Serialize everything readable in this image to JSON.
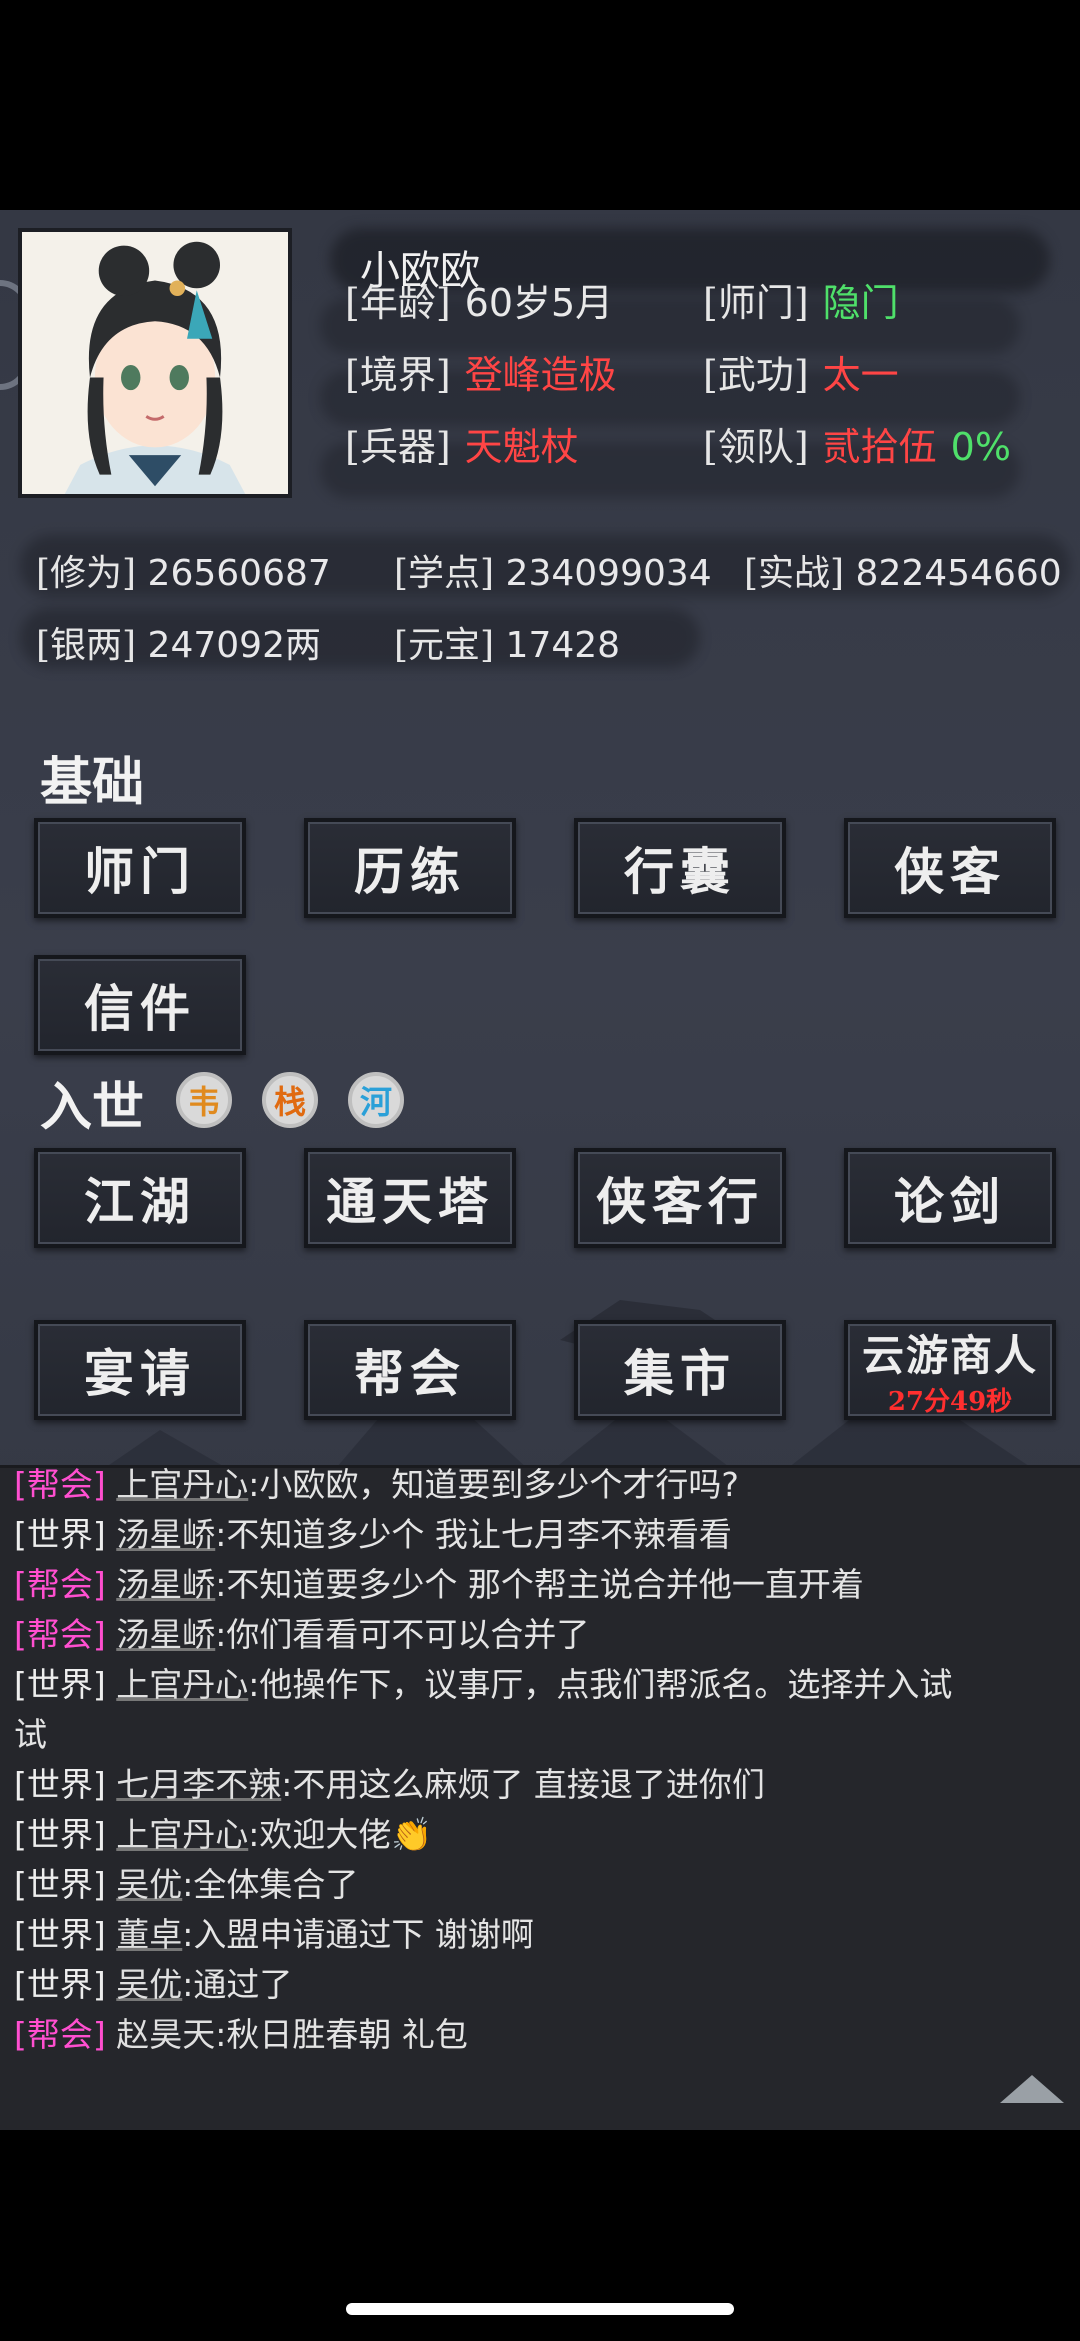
{
  "player": {
    "name": "小欧欧",
    "info": [
      {
        "label": "[年龄]",
        "value": "60岁5月",
        "color": "white"
      },
      {
        "label": "[师门]",
        "value": "隐门",
        "color": "green"
      },
      {
        "label": "[境界]",
        "value": "登峰造极",
        "color": "red"
      },
      {
        "label": "[武功]",
        "value": "太一",
        "color": "red"
      },
      {
        "label": "[兵器]",
        "value": "天魁杖",
        "color": "red"
      },
      {
        "label": "[领队]",
        "value": "贰拾伍",
        "value2": "0%",
        "color": "red"
      }
    ],
    "stats": [
      {
        "label": "[修为]",
        "value": "26560687"
      },
      {
        "label": "[学点]",
        "value": "234099034"
      },
      {
        "label": "[实战]",
        "value": "822454660"
      },
      {
        "label": "[银两]",
        "value": "247092两"
      },
      {
        "label": "[元宝]",
        "value": "17428"
      }
    ]
  },
  "sections": {
    "basic_title": "基础",
    "basic_buttons": [
      "师门",
      "历练",
      "行囊",
      "侠客",
      "信件"
    ],
    "world_title": "入世",
    "seals": [
      {
        "glyph": "韦",
        "color": "#e08a1e"
      },
      {
        "glyph": "栈",
        "color": "#e06a10"
      },
      {
        "glyph": "河",
        "color": "#2aa0d8"
      }
    ],
    "world_buttons": [
      "江湖",
      "通天塔",
      "侠客行",
      "论剑",
      "宴请",
      "帮会",
      "集市",
      "云游商人"
    ],
    "merchant_timer": "27分49秒"
  },
  "chat": [
    {
      "channel": "[帮会]",
      "type": "guild",
      "speaker": "上官丹心",
      "text": ":小欧欧，知道要到多少个才行吗?"
    },
    {
      "channel": "[世界]",
      "type": "world",
      "speaker": "汤星峤",
      "text": ":不知道多少个 我让七月李不辣看看"
    },
    {
      "channel": "[帮会]",
      "type": "guild",
      "speaker": "汤星峤",
      "text": ":不知道要多少个 那个帮主说合并他一直开着"
    },
    {
      "channel": "[帮会]",
      "type": "guild",
      "speaker": "汤星峤",
      "text": ":你们看看可不可以合并了"
    },
    {
      "channel": "[世界]",
      "type": "world",
      "speaker": "上官丹心",
      "text": ":他操作下，议事厅，点我们帮派名。选择并入试",
      "cont": "试"
    },
    {
      "channel": "[世界]",
      "type": "world",
      "speaker": "七月李不辣",
      "text": ":不用这么麻烦了 直接退了进你们"
    },
    {
      "channel": "[世界]",
      "type": "world",
      "speaker": "上官丹心",
      "text": ":欢迎大佬👏"
    },
    {
      "channel": "[世界]",
      "type": "world",
      "speaker": "吴优",
      "text": ":全体集合了"
    },
    {
      "channel": "[世界]",
      "type": "world",
      "speaker": "董卓",
      "text": ":入盟申请通过下 谢谢啊"
    },
    {
      "channel": "[世界]",
      "type": "world",
      "speaker": "吴优",
      "text": ":通过了"
    },
    {
      "channel": "[帮会]",
      "type": "guild",
      "speaker": "赵昊天",
      "text": ":秋日胜春朝 礼包"
    }
  ]
}
